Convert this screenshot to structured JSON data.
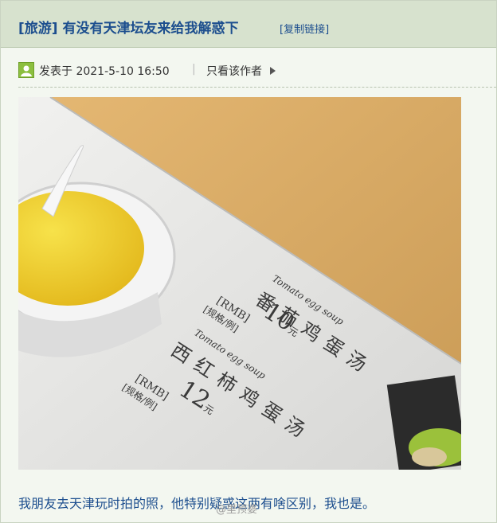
{
  "thread": {
    "category": "[旅游]",
    "title": "有没有天津坛友来给我解惑下",
    "copy_link": "[复制链接]"
  },
  "meta": {
    "posted_at": "发表于 2021-5-10 16:50",
    "separator": "|",
    "author_only": "只看该作者"
  },
  "photo": {
    "upper_dish": {
      "en": "Tomato egg soup",
      "currency": "[RMB]",
      "spec": "[规格/例]",
      "price": "10",
      "unit": "元",
      "name": "番茄鸡蛋汤"
    },
    "lower_dish": {
      "en": "Tomato egg soup",
      "currency": "[RMB]",
      "spec": "[规格/例]",
      "price": "12",
      "unit": "元",
      "name": "西红柿鸡蛋汤"
    }
  },
  "post": {
    "text": "我朋友去天津玩时拍的照，他特别疑惑这两有啥区别，我也是。"
  },
  "watermark": "@里预婆",
  "colors": {
    "title_bar": "#d7e2ce",
    "link_blue": "#1c4e8e",
    "page_bg": "#f3f7f0"
  }
}
